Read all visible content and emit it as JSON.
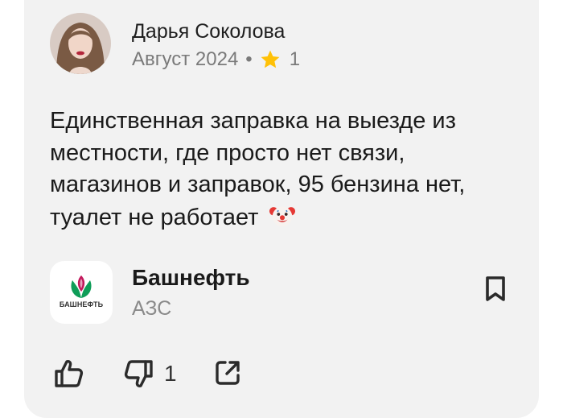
{
  "review": {
    "author": {
      "name": "Дарья Соколова",
      "avatar_icon": "user-avatar-photo"
    },
    "date": "Август 2024",
    "separator": "•",
    "rating_icon": "star-icon",
    "rating": "1",
    "text": "Единственная заправка на выезде из местности, где просто нет связи, магазинов и заправок, 95 бензина нет, туалет не работает",
    "emoji_icon": "clown-face-emoji"
  },
  "organization": {
    "logo_text": "БАШНЕФТЬ",
    "name": "Башнефть",
    "type": "АЗС"
  },
  "actions": {
    "dislike_count": "1"
  },
  "colors": {
    "card_background": "#f2f2f2",
    "star": "#ffc107",
    "logo_green": "#0f9d58",
    "logo_pink": "#c2185b"
  }
}
